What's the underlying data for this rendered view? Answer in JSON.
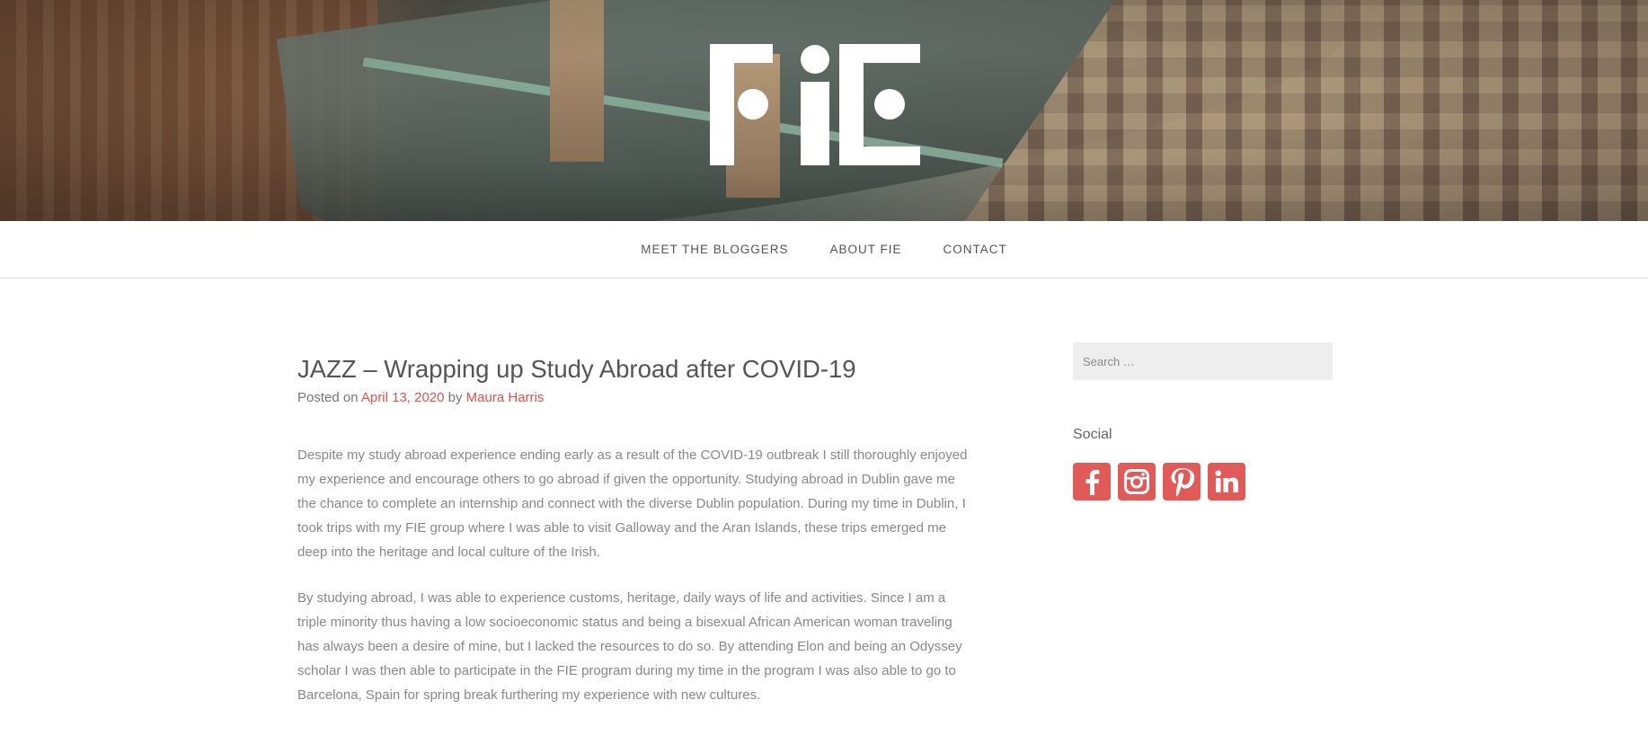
{
  "header": {
    "logo_alt": "FIE"
  },
  "nav": {
    "items": [
      {
        "label": "MEET THE BLOGGERS"
      },
      {
        "label": "ABOUT FIE"
      },
      {
        "label": "CONTACT"
      }
    ]
  },
  "post": {
    "title": "JAZZ – Wrapping up Study Abroad after COVID-19",
    "posted_on_prefix": "Posted on ",
    "date": "April 13, 2020",
    "by_text": " by ",
    "author": "Maura Harris",
    "paragraphs": [
      "Despite my study abroad experience ending early as a result of the COVID-19 outbreak I still thoroughly enjoyed my experience and encourage others to go abroad if given the opportunity. Studying abroad in Dublin gave me the chance to complete an internship and connect with the diverse Dublin population. During my time in Dublin, I took trips with my FIE group where I was able to visit Galloway and the Aran Islands, these trips emerged me deep into the heritage and local culture of the Irish.",
      "By studying abroad, I was able to experience customs, heritage, daily ways of life and activities. Since I am a triple minority thus having a low socioeconomic status and being a bisexual African American woman traveling has always been a desire of mine, but I lacked the resources to do so. By attending Elon and being an Odyssey scholar I was then able to participate in the FIE program during my time in the program I was also able to go to Barcelona, Spain for spring break furthering my experience with new cultures."
    ]
  },
  "sidebar": {
    "search": {
      "placeholder": "Search …"
    },
    "social": {
      "title": "Social",
      "icons": [
        "facebook-icon",
        "instagram-icon",
        "pinterest-icon",
        "linkedin-icon"
      ]
    }
  },
  "colors": {
    "accent": "#d9534f",
    "social_bg": "#e05a57",
    "text": "#666666",
    "body_text": "#888888"
  }
}
